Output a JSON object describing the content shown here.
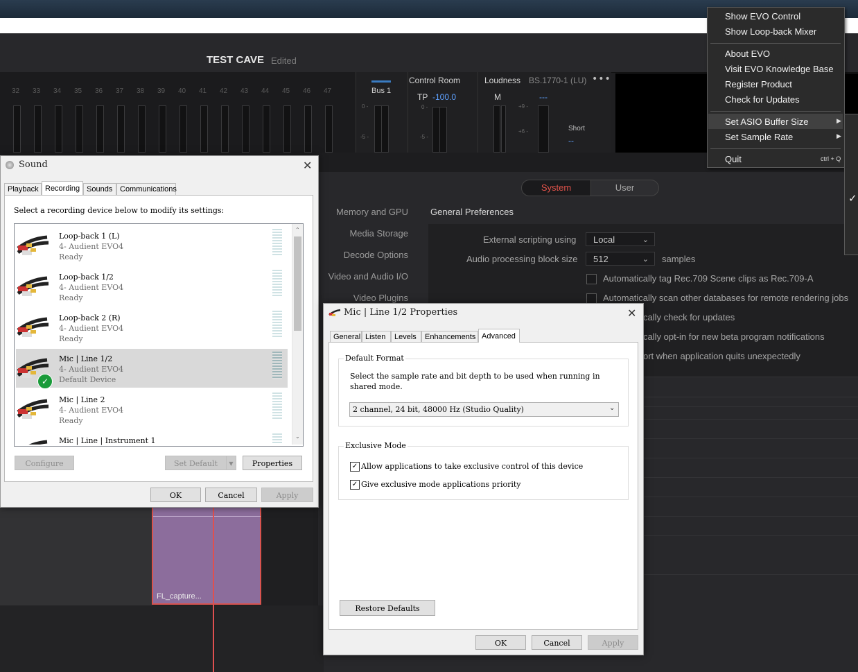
{
  "resolve": {
    "project_title": "TEST CAVE",
    "project_status": "Edited",
    "track_numbers": [
      "32",
      "33",
      "34",
      "35",
      "36",
      "37",
      "38",
      "39",
      "40",
      "41",
      "42",
      "43",
      "44",
      "45",
      "46",
      "47"
    ],
    "bus_label": "Bus 1",
    "control_room": {
      "title": "Control Room",
      "tp_label": "TP",
      "tp_value": "-100.0"
    },
    "loudness": {
      "title": "Loudness",
      "standard": "BS.1770-1 (LU)",
      "more": "•••",
      "m_label": "M",
      "m_value": "---",
      "short_label": "Short",
      "short_value": "--"
    },
    "meter_scale": {
      "zero": "0 -",
      "minus5": "-5 -",
      "plus9": "+9 -",
      "plus6": "+6 -"
    },
    "segment": {
      "system": "System",
      "user": "User",
      "active": "System"
    },
    "categories": [
      "Memory and GPU",
      "Media Storage",
      "Decode Options",
      "Video and Audio I/O",
      "Video Plugins"
    ],
    "general_prefs_title": "General Preferences",
    "prefs": {
      "scripting_label": "External scripting using",
      "scripting_value": "Local",
      "block_label": "Audio processing block size",
      "block_value": "512",
      "block_unit": "samples",
      "cb1": "Automatically tag Rec.709 Scene clips as Rec.709-A",
      "cb2": "Automatically scan other databases for remote rendering jobs",
      "cb3": "cally check for updates",
      "cb4": "cally opt-in for new beta program notifications",
      "cb5": "ort when application quits unexpectedly"
    },
    "clip_label": "FL_capture..."
  },
  "context_menu": {
    "items": [
      "Show EVO Control",
      "Show Loop-back Mixer",
      "About EVO",
      "Visit EVO Knowledge Base",
      "Register Product",
      "Check for Updates",
      "Set ASIO Buffer Size",
      "Set Sample Rate",
      "Quit"
    ],
    "quit_shortcut": "ctrl + Q",
    "highlighted": "Set ASIO Buffer Size",
    "submenu_check": "✓"
  },
  "sound_dialog": {
    "title": "Sound",
    "tabs": [
      "Playback",
      "Recording",
      "Sounds",
      "Communications"
    ],
    "active_tab": "Recording",
    "instruction": "Select a recording device below to modify its settings:",
    "devices": [
      {
        "name": "Loop-back 1 (L)",
        "device": "4- Audient EVO4",
        "status": "Ready"
      },
      {
        "name": "Loop-back 1/2",
        "device": "4- Audient EVO4",
        "status": "Ready"
      },
      {
        "name": "Loop-back 2 (R)",
        "device": "4- Audient EVO4",
        "status": "Ready"
      },
      {
        "name": "Mic | Line 1/2",
        "device": "4- Audient EVO4",
        "status": "Default Device"
      },
      {
        "name": "Mic | Line 2",
        "device": "4- Audient EVO4",
        "status": "Ready"
      },
      {
        "name": "Mic | Line | Instrument 1",
        "device": "",
        "status": ""
      }
    ],
    "selected_device": "Mic | Line 1/2",
    "buttons": {
      "configure": "Configure",
      "set_default": "Set Default",
      "properties": "Properties",
      "ok": "OK",
      "cancel": "Cancel",
      "apply": "Apply"
    }
  },
  "props_dialog": {
    "title": "Mic | Line 1/2 Properties",
    "tabs": [
      "General",
      "Listen",
      "Levels",
      "Enhancements",
      "Advanced"
    ],
    "active_tab": "Advanced",
    "default_format_label": "Default Format",
    "default_format_desc": "Select the sample rate and bit depth to be used when running in shared mode.",
    "format_value": "2 channel, 24 bit, 48000 Hz (Studio Quality)",
    "exclusive_label": "Exclusive Mode",
    "exclusive_allow": "Allow applications to take exclusive control of this device",
    "exclusive_priority": "Give exclusive mode applications priority",
    "exclusive_allow_checked": true,
    "exclusive_priority_checked": true,
    "restore_defaults": "Restore Defaults",
    "buttons": {
      "ok": "OK",
      "cancel": "Cancel",
      "apply": "Apply"
    }
  }
}
